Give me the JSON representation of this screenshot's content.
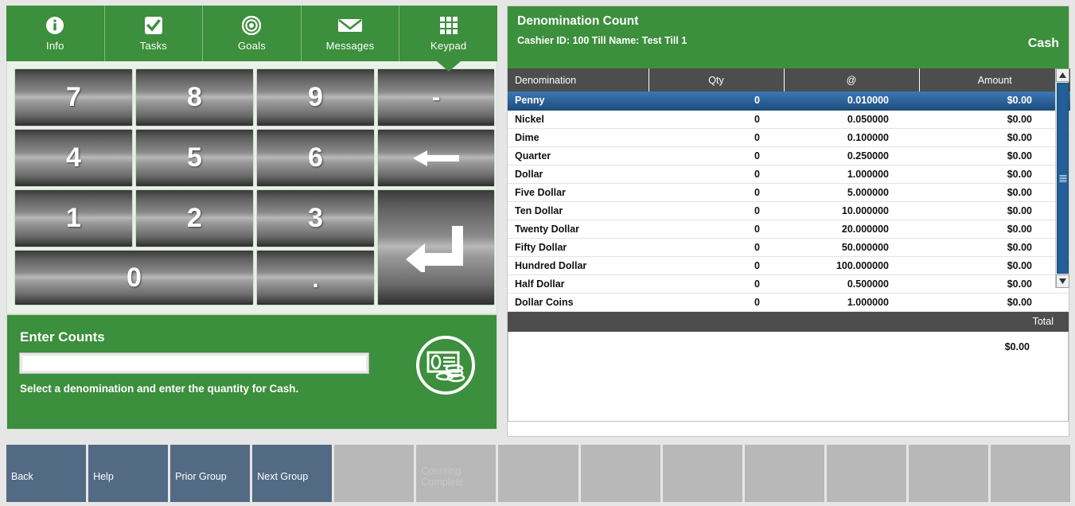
{
  "nav": {
    "tabs": [
      {
        "label": "Info",
        "icon": "info-icon"
      },
      {
        "label": "Tasks",
        "icon": "checkbox-icon"
      },
      {
        "label": "Goals",
        "icon": "target-icon"
      },
      {
        "label": "Messages",
        "icon": "envelope-icon"
      },
      {
        "label": "Keypad",
        "icon": "keypad-grid-icon",
        "active": true
      }
    ]
  },
  "keypad": {
    "keys": [
      {
        "label": "7",
        "name": "key-7"
      },
      {
        "label": "8",
        "name": "key-8"
      },
      {
        "label": "9",
        "name": "key-9"
      },
      {
        "label": "-",
        "name": "key-minus"
      },
      {
        "label": "4",
        "name": "key-4"
      },
      {
        "label": "5",
        "name": "key-5"
      },
      {
        "label": "6",
        "name": "key-6"
      },
      {
        "label": "",
        "name": "key-backspace"
      },
      {
        "label": "1",
        "name": "key-1"
      },
      {
        "label": "2",
        "name": "key-2"
      },
      {
        "label": "3",
        "name": "key-3"
      },
      {
        "label": "",
        "name": "key-enter"
      },
      {
        "label": "0",
        "name": "key-0"
      },
      {
        "label": ".",
        "name": "key-decimal"
      }
    ]
  },
  "enter_counts": {
    "title": "Enter Counts",
    "input_value": "",
    "input_placeholder": "",
    "hint": "Select a denomination and enter the quantity for Cash.",
    "icon": "cash-money-icon"
  },
  "denomination_count": {
    "title": "Denomination Count",
    "subtitle": "Cashier ID:  100  Till Name:  Test Till 1",
    "mode": "Cash",
    "columns": [
      "Denomination",
      "Qty",
      "@",
      "Amount"
    ],
    "rows": [
      {
        "denomination": "Penny",
        "qty": "0",
        "rate": "0.010000",
        "amount": "$0.00",
        "selected": true
      },
      {
        "denomination": "Nickel",
        "qty": "0",
        "rate": "0.050000",
        "amount": "$0.00"
      },
      {
        "denomination": "Dime",
        "qty": "0",
        "rate": "0.100000",
        "amount": "$0.00"
      },
      {
        "denomination": "Quarter",
        "qty": "0",
        "rate": "0.250000",
        "amount": "$0.00"
      },
      {
        "denomination": "Dollar",
        "qty": "0",
        "rate": "1.000000",
        "amount": "$0.00"
      },
      {
        "denomination": "Five Dollar",
        "qty": "0",
        "rate": "5.000000",
        "amount": "$0.00"
      },
      {
        "denomination": "Ten Dollar",
        "qty": "0",
        "rate": "10.000000",
        "amount": "$0.00"
      },
      {
        "denomination": "Twenty Dollar",
        "qty": "0",
        "rate": "20.000000",
        "amount": "$0.00"
      },
      {
        "denomination": "Fifty Dollar",
        "qty": "0",
        "rate": "50.000000",
        "amount": "$0.00"
      },
      {
        "denomination": "Hundred Dollar",
        "qty": "0",
        "rate": "100.000000",
        "amount": "$0.00"
      },
      {
        "denomination": "Half Dollar",
        "qty": "0",
        "rate": "0.500000",
        "amount": "$0.00"
      },
      {
        "denomination": "Dollar Coins",
        "qty": "0",
        "rate": "1.000000",
        "amount": "$0.00"
      }
    ],
    "total_label": "Total",
    "total_value": "$0.00"
  },
  "toolbar": {
    "buttons": [
      {
        "label": "Back",
        "state": "enabled"
      },
      {
        "label": "Help",
        "state": "enabled"
      },
      {
        "label": "Prior Group",
        "state": "enabled"
      },
      {
        "label": "Next Group",
        "state": "enabled"
      },
      {
        "label": "",
        "state": "empty"
      },
      {
        "label": "Counting Complete",
        "state": "disabled"
      },
      {
        "label": "",
        "state": "empty"
      },
      {
        "label": "",
        "state": "empty"
      },
      {
        "label": "",
        "state": "empty"
      },
      {
        "label": "",
        "state": "empty"
      },
      {
        "label": "",
        "state": "empty"
      },
      {
        "label": "",
        "state": "empty"
      },
      {
        "label": "",
        "state": "empty"
      }
    ]
  },
  "colors": {
    "brand_green": "#3c8f3c",
    "header_gray": "#4d4d4d",
    "selected_blue": "#2d6399",
    "toolbar_blue": "#536a85",
    "disabled_gray": "#b8b8b8"
  }
}
